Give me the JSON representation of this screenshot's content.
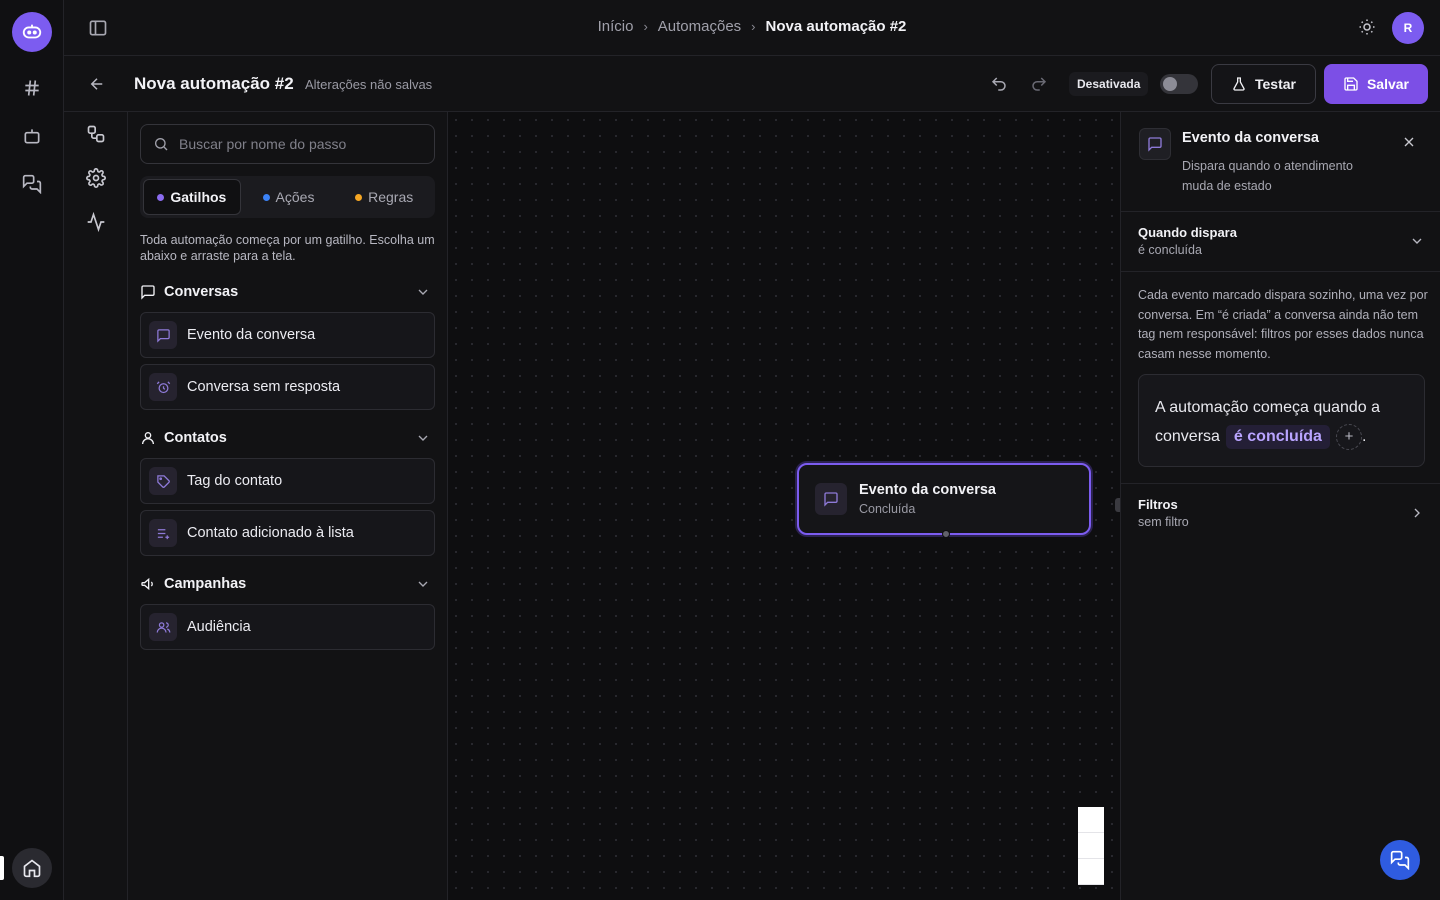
{
  "breadcrumb": {
    "items": [
      "Início",
      "Automações"
    ],
    "current": "Nova automação #2"
  },
  "user": {
    "avatar_initial": "R"
  },
  "toolbar": {
    "title": "Nova automação #2",
    "unsaved_label": "Alterações não salvas",
    "status_label": "Desativada",
    "active": false,
    "test_label": "Testar",
    "save_label": "Salvar"
  },
  "steps_panel": {
    "search_placeholder": "Buscar por nome do passo",
    "tabs": [
      {
        "label": "Gatilhos",
        "color": "#8b6cf0",
        "active": true
      },
      {
        "label": "Ações",
        "color": "#3b82f6",
        "active": false
      },
      {
        "label": "Regras",
        "color": "#f5a623",
        "active": false
      }
    ],
    "intro": "Toda automação começa por um gatilho. Escolha um abaixo e arraste para a tela.",
    "groups": [
      {
        "label": "Conversas",
        "icon": "message-square-icon",
        "items": [
          {
            "label": "Evento da conversa",
            "icon": "message-square-icon"
          },
          {
            "label": "Conversa sem resposta",
            "icon": "alarm-clock-icon"
          }
        ]
      },
      {
        "label": "Contatos",
        "icon": "user-icon",
        "items": [
          {
            "label": "Tag do contato",
            "icon": "tag-icon"
          },
          {
            "label": "Contato adicionado à lista",
            "icon": "list-plus-icon"
          }
        ]
      },
      {
        "label": "Campanhas",
        "icon": "megaphone-icon",
        "items": [
          {
            "label": "Audiência",
            "icon": "users-icon"
          }
        ]
      }
    ]
  },
  "canvas": {
    "node": {
      "title": "Evento da conversa",
      "subtitle": "Concluída"
    }
  },
  "properties": {
    "title": "Evento da conversa",
    "description": "Dispara quando o atendimento muda de estado",
    "when": {
      "label": "Quando dispara",
      "value": "é concluída"
    },
    "note": "Cada evento marcado dispara sozinho, uma vez por conversa. Em “é criada” a conversa ainda não tem tag nem responsável: filtros por esses dados nunca casam nesse momento.",
    "sentence": {
      "prefix": "A automação começa quando a conversa",
      "pill": "é concluída",
      "suffix": "."
    },
    "filters": {
      "label": "Filtros",
      "value": "sem filtro"
    }
  },
  "colors": {
    "accent": "#7c4fe6",
    "brand": "#7c5cf0",
    "chat_fab": "#2f5ce0"
  }
}
